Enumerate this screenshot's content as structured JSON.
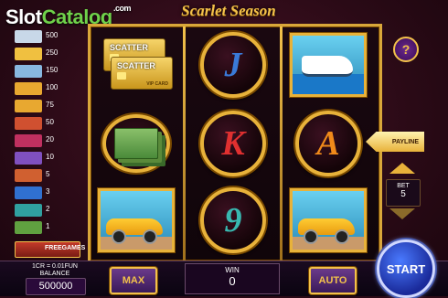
{
  "watermark": {
    "slot": "Slot",
    "catalog": "Catalog",
    "com": ".com"
  },
  "game_title": "Scarlet Season",
  "paytable": {
    "rows": [
      {
        "value": "500",
        "color": "#c8d8e8"
      },
      {
        "value": "250",
        "color": "#f0c040"
      },
      {
        "value": "150",
        "color": "#88b8e0"
      },
      {
        "value": "100",
        "color": "#e8a830"
      },
      {
        "value": "75",
        "color": "#e8a830"
      },
      {
        "value": "50",
        "color": "#d05030"
      },
      {
        "value": "20",
        "color": "#c03060"
      },
      {
        "value": "10",
        "color": "#8050c0"
      },
      {
        "value": "5",
        "color": "#d06030"
      },
      {
        "value": "3",
        "color": "#3070d0"
      },
      {
        "value": "2",
        "color": "#30a0a0"
      },
      {
        "value": "1",
        "color": "#60a040"
      }
    ],
    "freegames_label": "FREEGAMES"
  },
  "reels": {
    "scatter_card": {
      "label": "SCATTER",
      "vip": "VIP CARD"
    },
    "letters": {
      "j": "J",
      "k": "K",
      "a": "A",
      "nine": "9"
    }
  },
  "controls": {
    "help": "?",
    "payline": "PAYLINE",
    "bet_label": "BET",
    "bet_value": "5"
  },
  "bottom": {
    "denomination": "1CR = 0.01FUN",
    "balance_label": "BALANCE",
    "balance_value": "500000",
    "max_label": "MAX",
    "win_label": "WIN",
    "win_value": "0",
    "auto_label": "AUTO",
    "start_label": "START"
  }
}
